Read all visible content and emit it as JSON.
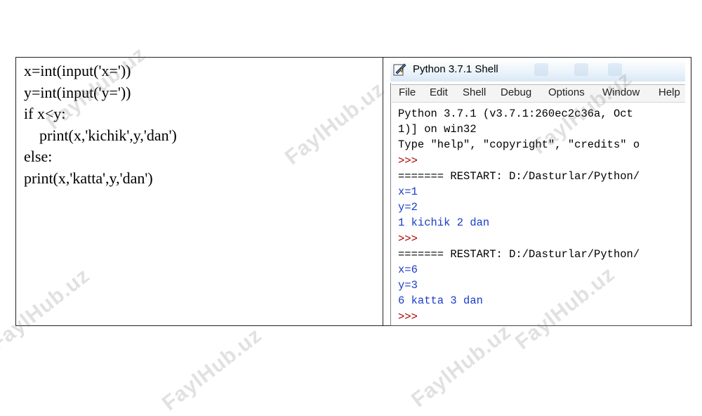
{
  "editor": {
    "lines": [
      "x=int(input('x='))",
      "y=int(input('y='))",
      "if x<y:",
      "    print(x,'kichik',y,'dan')",
      "else:",
      "print(x,'katta',y,'dan')"
    ]
  },
  "shell": {
    "title": "Python 3.7.1 Shell",
    "menu": [
      "File",
      "Edit",
      "Shell",
      "Debug",
      "Options",
      "Window",
      "Help"
    ],
    "output": [
      {
        "text": "Python 3.7.1 (v3.7.1:260ec2c36a, Oct",
        "color": "black"
      },
      {
        "text": "1)] on win32",
        "color": "black"
      },
      {
        "text": "Type \"help\", \"copyright\", \"credits\" o",
        "color": "black"
      },
      {
        "text": ">>>",
        "color": "red"
      },
      {
        "text": "======= RESTART: D:/Dasturlar/Python/",
        "color": "black"
      },
      {
        "text": "x=1",
        "color": "blue"
      },
      {
        "text": "y=2",
        "color": "blue"
      },
      {
        "text": "1 kichik 2 dan",
        "color": "blue"
      },
      {
        "text": ">>>",
        "color": "red"
      },
      {
        "text": "======= RESTART: D:/Dasturlar/Python/",
        "color": "black"
      },
      {
        "text": "x=6",
        "color": "blue"
      },
      {
        "text": "y=3",
        "color": "blue"
      },
      {
        "text": "6 katta 3 dan",
        "color": "blue"
      },
      {
        "text": ">>>",
        "color": "red"
      }
    ]
  },
  "watermark": "FaylHub.uz"
}
